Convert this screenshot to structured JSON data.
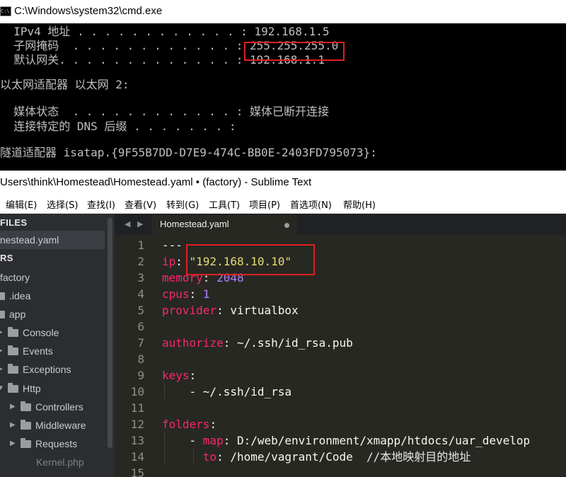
{
  "cmd": {
    "window_title": "C:\\Windows\\system32\\cmd.exe",
    "icon_text": "C:\\.",
    "lines": [
      "  IPv4 地址 . . . . . . . . . . . . : 192.168.1.5",
      "  子网掩码  . . . . . . . . . . . . : 255.255.255.0",
      "  默认网关. . . . . . . . . . . . . : 192.168.1.1",
      "",
      "以太网适配器 以太网 2:",
      "",
      "  媒体状态  . . . . . . . . . . . . : 媒体已断开连接",
      "  连接特定的 DNS 后缀 . . . . . . . :",
      "",
      "隧道适配器 isatap.{9F55B7DD-D7E9-474C-BB0E-2403FD795073}:"
    ]
  },
  "sublime": {
    "window_title": "Users\\think\\Homestead\\Homestead.yaml • (factory) - Sublime Text",
    "menu": [
      "编辑(E)",
      "选择(S)",
      "查找(I)",
      "查看(V)",
      "转到(G)",
      "工具(T)",
      "项目(P)",
      "首选项(N)",
      "帮助(H)"
    ],
    "sidebar": {
      "open_files_header": "FILES",
      "open_file": "nestead.yaml",
      "folders_header": "RS",
      "root_folder": "factory",
      "items": [
        {
          "label": ".idea",
          "depth": 0
        },
        {
          "label": "app",
          "depth": 0,
          "open": true
        },
        {
          "label": "Console",
          "depth": 1
        },
        {
          "label": "Events",
          "depth": 1
        },
        {
          "label": "Exceptions",
          "depth": 1
        },
        {
          "label": "Http",
          "depth": 1,
          "open": true
        },
        {
          "label": "Controllers",
          "depth": 2
        },
        {
          "label": "Middleware",
          "depth": 2
        },
        {
          "label": "Requests",
          "depth": 2
        },
        {
          "label": "Kernel.php",
          "depth": 2,
          "file": true
        }
      ]
    },
    "tab": {
      "label": "Homestead.yaml"
    },
    "line_numbers": [
      "1",
      "2",
      "3",
      "4",
      "5",
      "6",
      "7",
      "8",
      "9",
      "10",
      "11",
      "12",
      "13",
      "14",
      "15"
    ],
    "code": {
      "l1": "---",
      "ip_key": "ip",
      "ip_val": "\"192.168.10.10\"",
      "memory_key": "memory",
      "memory_val": "2048",
      "cpus_key": "cpus",
      "cpus_val": "1",
      "provider_key": "provider",
      "provider_val": "virtualbox",
      "authorize_key": "authorize",
      "authorize_val": "~/.ssh/id_rsa.pub",
      "keys_key": "keys",
      "keys_item": "- ~/.ssh/id_rsa",
      "folders_key": "folders",
      "map_key": "map",
      "map_val": "D:/web/environment/xmapp/htdocs/uar_develop",
      "to_key": "to",
      "to_val": "/home/vagrant/Code",
      "to_comment": "//本地映射目的地址"
    }
  },
  "colors": {
    "highlight_box": "#e02020",
    "editor_bg": "#272822",
    "sidebar_bg": "#2b2d30",
    "yaml_key": "#f92672",
    "yaml_string": "#e6db74",
    "yaml_number": "#ae81ff"
  }
}
